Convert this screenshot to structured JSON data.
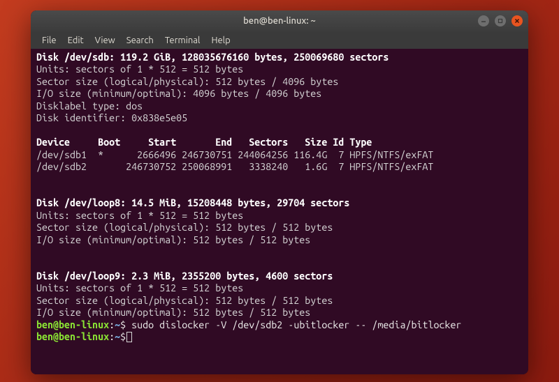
{
  "window": {
    "title": "ben@ben-linux: ~"
  },
  "menubar": {
    "items": [
      "File",
      "Edit",
      "View",
      "Search",
      "Terminal",
      "Help"
    ]
  },
  "terminal": {
    "lines": {
      "disk_sdb_header": "Disk /dev/sdb: 119.2 GiB, 128035676160 bytes, 250069680 sectors",
      "units1": "Units: sectors of 1 * 512 = 512 bytes",
      "sector1": "Sector size (logical/physical): 512 bytes / 4096 bytes",
      "io1": "I/O size (minimum/optimal): 4096 bytes / 4096 bytes",
      "disklabel": "Disklabel type: dos",
      "diskid": "Disk identifier: 0x838e5e05",
      "part_header": "Device     Boot     Start       End   Sectors   Size Id Type",
      "part1": "/dev/sdb1  *      2666496 246730751 244064256 116.4G  7 HPFS/NTFS/exFAT",
      "part2": "/dev/sdb2       246730752 250068991   3338240   1.6G  7 HPFS/NTFS/exFAT",
      "disk_loop8_header": "Disk /dev/loop8: 14.5 MiB, 15208448 bytes, 29704 sectors",
      "units2": "Units: sectors of 1 * 512 = 512 bytes",
      "sector2": "Sector size (logical/physical): 512 bytes / 512 bytes",
      "io2": "I/O size (minimum/optimal): 512 bytes / 512 bytes",
      "disk_loop9_header": "Disk /dev/loop9: 2.3 MiB, 2355200 bytes, 4600 sectors",
      "units3": "Units: sectors of 1 * 512 = 512 bytes",
      "sector3": "Sector size (logical/physical): 512 bytes / 512 bytes",
      "io3": "I/O size (minimum/optimal): 512 bytes / 512 bytes"
    },
    "prompt": {
      "userhost": "ben@ben-linux",
      "colon": ":",
      "path": "~",
      "sym": "$",
      "cmd1": " sudo dislocker -V /dev/sdb2 -ubitlocker -- /media/bitlocker",
      "cmd2": " "
    }
  }
}
